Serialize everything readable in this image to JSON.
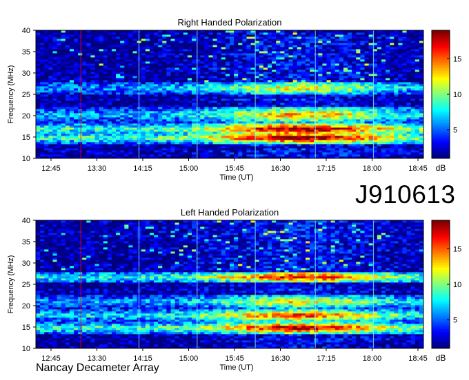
{
  "page": {
    "title": "J910613",
    "footer": "Nancay Decameter Array"
  },
  "chart_data": [
    {
      "type": "heatmap",
      "title": "Right Handed Polarization",
      "xlabel": "Time (UT)",
      "ylabel": "Frequency (MHz)",
      "x_ticks": [
        "12:45",
        "13:30",
        "14:15",
        "15:00",
        "15:45",
        "16:30",
        "17:15",
        "18:00",
        "18:45"
      ],
      "y_ticks": [
        10,
        15,
        20,
        25,
        30,
        35,
        40
      ],
      "ylim": [
        10,
        40
      ],
      "colorbar": {
        "label": "dB",
        "ticks": [
          5,
          10,
          15
        ],
        "range": [
          1,
          19
        ]
      },
      "colormap": [
        "#00007f",
        "#0000ff",
        "#007fff",
        "#00ffff",
        "#7fff7f",
        "#ffff00",
        "#ff7f00",
        "#ff0000",
        "#7f0000"
      ],
      "bands": [
        {
          "freq": [
            14.2,
            15.5
          ],
          "level": 17
        },
        {
          "freq": [
            16.0,
            17.8
          ],
          "level": 16
        },
        {
          "freq": [
            19.0,
            21.5
          ],
          "level": 12
        },
        {
          "freq": [
            25.5,
            27.5
          ],
          "level": 11
        }
      ]
    },
    {
      "type": "heatmap",
      "title": "Left Handed Polarization",
      "xlabel": "Time (UT)",
      "ylabel": "Frequency (MHz)",
      "x_ticks": [
        "12:45",
        "13:30",
        "14:15",
        "15:00",
        "15:45",
        "16:30",
        "17:15",
        "18:00",
        "18:45"
      ],
      "y_ticks": [
        10,
        15,
        20,
        25,
        30,
        35,
        40
      ],
      "ylim": [
        10,
        40
      ],
      "colorbar": {
        "label": "dB",
        "ticks": [
          5,
          10,
          15
        ],
        "range": [
          1,
          19
        ]
      },
      "colormap": [
        "#00007f",
        "#0000ff",
        "#007fff",
        "#00ffff",
        "#7fff7f",
        "#ffff00",
        "#ff7f00",
        "#ff0000",
        "#7f0000"
      ],
      "bands": [
        {
          "freq": [
            14.2,
            15.5
          ],
          "level": 16
        },
        {
          "freq": [
            17.0,
            18.5
          ],
          "level": 14
        },
        {
          "freq": [
            20.0,
            22.0
          ],
          "level": 11
        },
        {
          "freq": [
            26.0,
            27.5
          ],
          "level": 15
        }
      ]
    }
  ]
}
